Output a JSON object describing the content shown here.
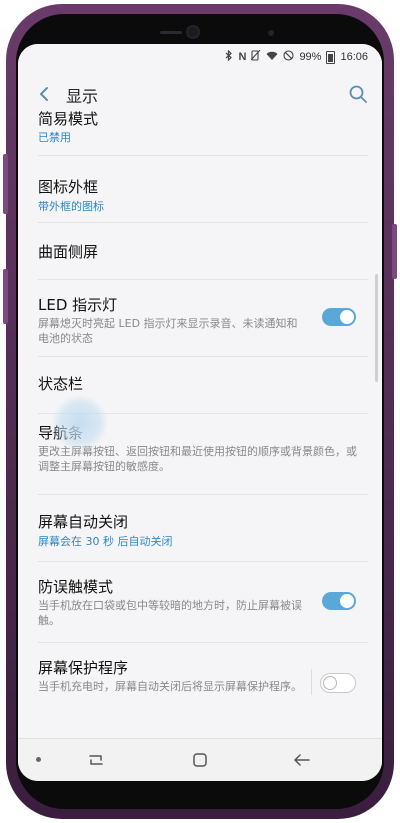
{
  "status": {
    "battery": "99%",
    "time": "16:06",
    "icons": [
      "bluetooth-icon",
      "nfc-icon",
      "mute-icon",
      "wifi-icon",
      "no-disturb-icon"
    ]
  },
  "header": {
    "title": "显示",
    "back_icon": "back-arrow-icon",
    "search_icon": "search-icon"
  },
  "items": [
    {
      "title": "简易模式",
      "subtitle": "已禁用"
    },
    {
      "title": "图标外框",
      "subtitle": "带外框的图标"
    },
    {
      "title": "曲面侧屏"
    },
    {
      "title": "LED 指示灯",
      "subtitle": "屏幕熄灭时亮起 LED 指示灯来显示录音、未读通知和电池的状态",
      "toggle": "on"
    },
    {
      "title": "状态栏"
    },
    {
      "title": "导航条",
      "subtitle": "更改主屏幕按钮、返回按钮和最近使用按钮的顺序或背景颜色，或调整主屏幕按钮的敏感度。"
    },
    {
      "title": "屏幕自动关闭",
      "subtitle": "屏幕会在 30 秒 后自动关闭"
    },
    {
      "title": "防误触模式",
      "subtitle": "当手机放在口袋或包中等较暗的地方时，防止屏幕被误触。",
      "toggle": "on"
    },
    {
      "title": "屏幕保护程序",
      "subtitle": "当手机充电时，屏幕自动关闭后将显示屏幕保护程序。",
      "toggle": "off"
    }
  ],
  "navbar": {
    "icons": [
      "nav-dot-icon",
      "recents-icon",
      "home-icon",
      "back-icon"
    ]
  },
  "colors": {
    "accent": "#5aa8d8",
    "link": "#2f86c4",
    "frame": "#5e3360"
  }
}
